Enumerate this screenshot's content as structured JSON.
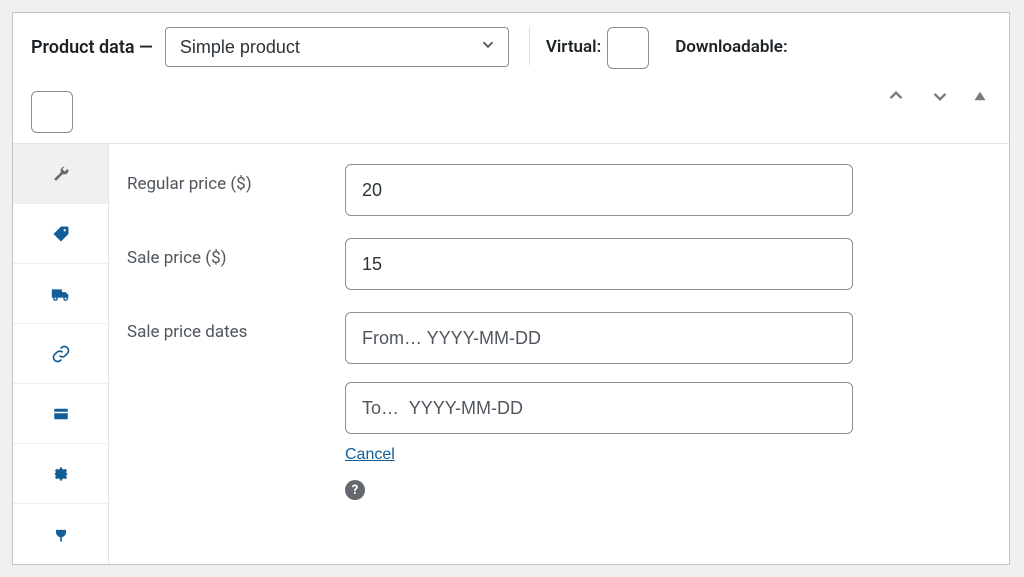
{
  "header": {
    "title": "Product data —",
    "product_type_selected": "Simple product",
    "virtual_label": "Virtual:",
    "downloadable_label": "Downloadable:"
  },
  "fields": {
    "regular_price_label": "Regular price ($)",
    "regular_price_value": "20",
    "sale_price_label": "Sale price ($)",
    "sale_price_value": "15",
    "sale_dates_label": "Sale price dates",
    "sale_from_placeholder": "From… YYYY-MM-DD",
    "sale_to_placeholder": "To…  YYYY-MM-DD",
    "cancel_label": "Cancel"
  }
}
